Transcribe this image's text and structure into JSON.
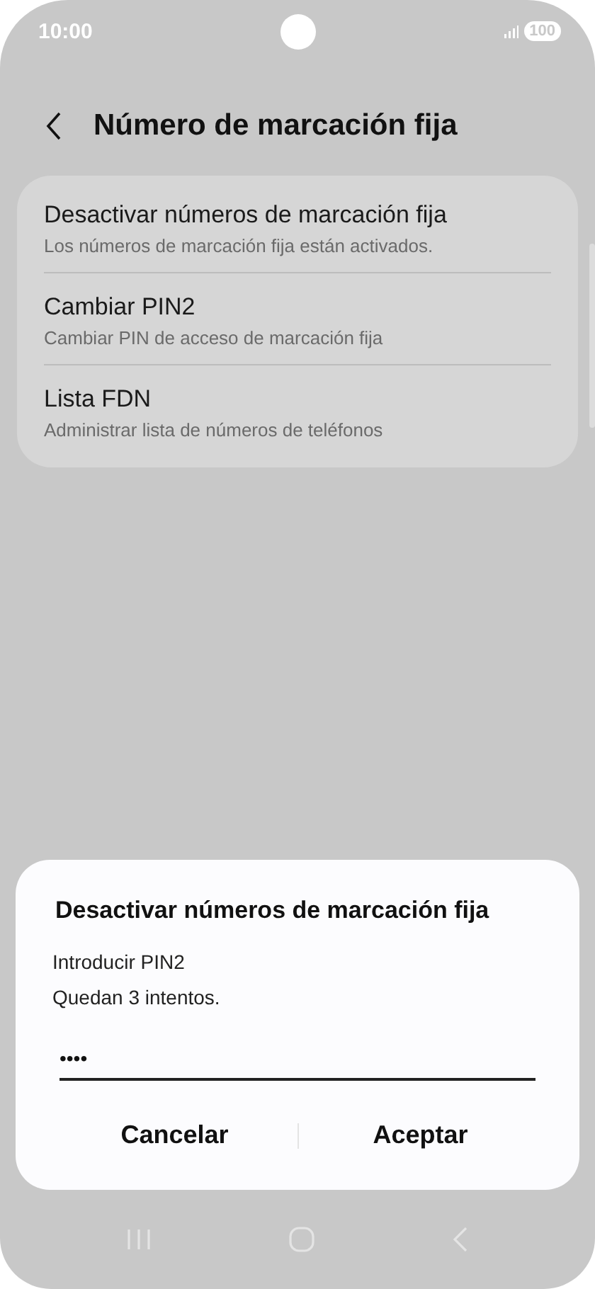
{
  "status_bar": {
    "time": "10:00",
    "battery": "100"
  },
  "header": {
    "title": "Número de marcación fija"
  },
  "settings": [
    {
      "title": "Desactivar números de marcación fija",
      "subtitle": "Los números de marcación fija están activados."
    },
    {
      "title": "Cambiar PIN2",
      "subtitle": "Cambiar PIN de acceso de marcación fija"
    },
    {
      "title": "Lista FDN",
      "subtitle": "Administrar lista de números de teléfonos"
    }
  ],
  "dialog": {
    "title": "Desactivar números de marcación fija",
    "messages": [
      "Introducir PIN2",
      "Quedan 3 intentos."
    ],
    "pin_field": {
      "value": "••••"
    },
    "buttons": [
      "Cancelar",
      "Aceptar"
    ]
  }
}
